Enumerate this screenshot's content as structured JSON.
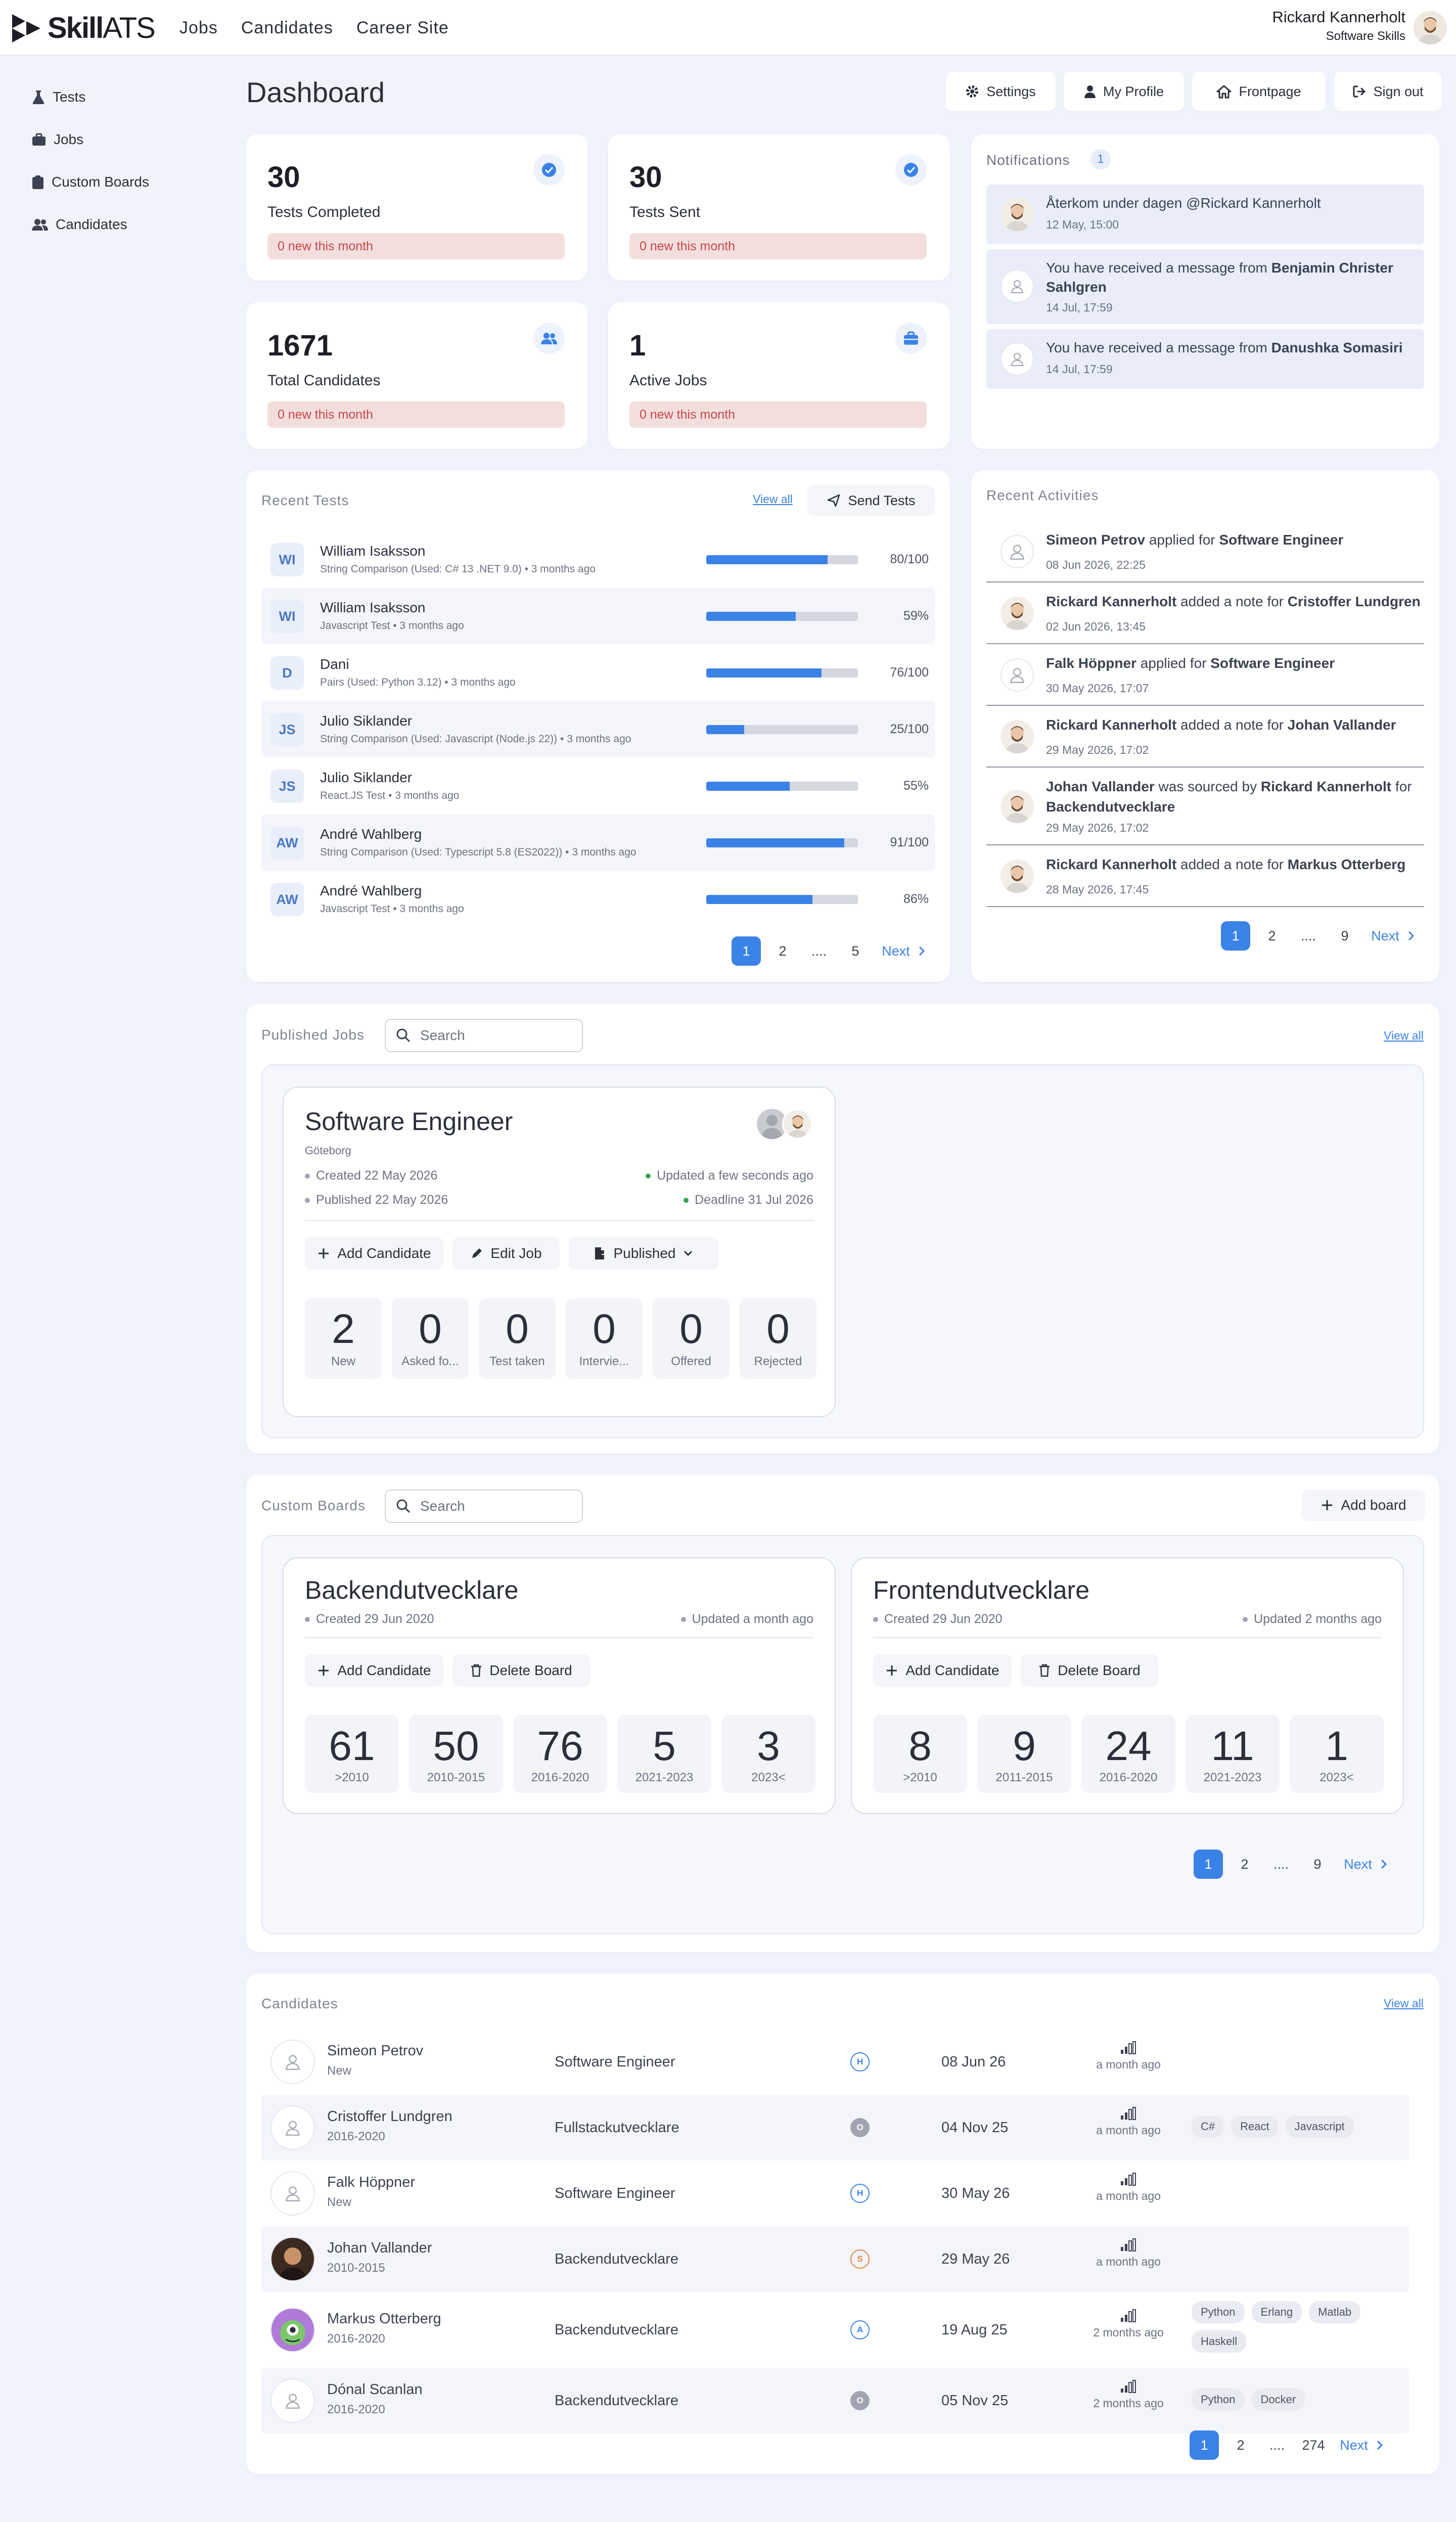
{
  "app": {
    "logo_bold": "Skill",
    "logo_light": "ATS",
    "nav": [
      "Jobs",
      "Candidates",
      "Career Site"
    ],
    "user_name": "Rickard Kannerholt",
    "user_company": "Software Skills"
  },
  "sidebar": {
    "items": [
      "Tests",
      "Jobs",
      "Custom Boards",
      "Candidates"
    ]
  },
  "page": {
    "title": "Dashboard"
  },
  "toolbar": {
    "settings": "Settings",
    "profile": "My Profile",
    "frontpage": "Frontpage",
    "signout": "Sign out"
  },
  "stats": [
    {
      "value": "30",
      "label": "Tests Completed",
      "badge": "0 new this month",
      "icon": "check-circle-icon"
    },
    {
      "value": "30",
      "label": "Tests Sent",
      "badge": "0 new this month",
      "icon": "check-circle-icon"
    },
    {
      "value": "1671",
      "label": "Total Candidates",
      "badge": "0 new this month",
      "icon": "users-icon"
    },
    {
      "value": "1",
      "label": "Active Jobs",
      "badge": "0 new this month",
      "icon": "briefcase-icon"
    }
  ],
  "notifications": {
    "title": "Notifications",
    "count": "1",
    "items": [
      {
        "text": "Återkom under dagen @Rickard Kannerholt",
        "date": "12 May, 15:00"
      },
      {
        "pre": "You have received a message from ",
        "bold": "Benjamin Christer Sahlgren",
        "date": "14 Jul, 17:59"
      },
      {
        "pre": "You have received a message from ",
        "bold": "Danushka Somasiri",
        "date": "14 Jul, 17:59"
      }
    ]
  },
  "recent_tests": {
    "title": "Recent Tests",
    "view_all": "View all",
    "send": "Send Tests",
    "rows": [
      {
        "initials": "WI",
        "name": "William Isaksson",
        "meta": "String Comparison (Used: C# 13 .NET 9.0) • 3 months ago",
        "score": "80/100",
        "pct": 0.8
      },
      {
        "initials": "WI",
        "name": "William Isaksson",
        "meta": "Javascript Test • 3 months ago",
        "score": "59%",
        "pct": 0.59
      },
      {
        "initials": "D",
        "name": "Dani",
        "meta": "Pairs (Used: Python 3.12) • 3 months ago",
        "score": "76/100",
        "pct": 0.76
      },
      {
        "initials": "JS",
        "name": "Julio Siklander",
        "meta": "String Comparison (Used: Javascript (Node.js 22)) • 3 months ago",
        "score": "25/100",
        "pct": 0.25
      },
      {
        "initials": "JS",
        "name": "Julio Siklander",
        "meta": "React.JS Test • 3 months ago",
        "score": "55%",
        "pct": 0.55
      },
      {
        "initials": "AW",
        "name": "André Wahlberg",
        "meta": "String Comparison (Used: Typescript 5.8 (ES2022)) • 3 months ago",
        "score": "91/100",
        "pct": 0.91
      },
      {
        "initials": "AW",
        "name": "André Wahlberg",
        "meta": "Javascript Test • 3 months ago",
        "score": "86%",
        "pct": 0.7
      }
    ],
    "pages": [
      "1",
      "2",
      "....",
      "5"
    ],
    "next": "Next"
  },
  "recent_activities": {
    "title": "Recent Activities",
    "items": [
      {
        "parts": [
          [
            "b",
            "Simeon Petrov"
          ],
          [
            "t",
            " applied for "
          ],
          [
            "b",
            "Software Engineer"
          ]
        ],
        "date": "08 Jun 2026, 22:25",
        "photo": false
      },
      {
        "parts": [
          [
            "b",
            "Rickard Kannerholt"
          ],
          [
            "t",
            " added a note for "
          ],
          [
            "b",
            "Cristoffer Lundgren"
          ]
        ],
        "date": "02 Jun 2026, 13:45",
        "photo": true
      },
      {
        "parts": [
          [
            "b",
            "Falk Höppner"
          ],
          [
            "t",
            " applied for "
          ],
          [
            "b",
            "Software Engineer"
          ]
        ],
        "date": "30 May 2026, 17:07",
        "photo": false
      },
      {
        "parts": [
          [
            "b",
            "Rickard Kannerholt"
          ],
          [
            "t",
            " added a note for "
          ],
          [
            "b",
            "Johan Vallander"
          ]
        ],
        "date": "29 May 2026, 17:02",
        "photo": true
      },
      {
        "parts": [
          [
            "b",
            "Johan Vallander"
          ],
          [
            "t",
            " was sourced by "
          ],
          [
            "b",
            "Rickard Kannerholt"
          ],
          [
            "t",
            " for "
          ],
          [
            "b",
            "Backendutvecklare"
          ]
        ],
        "date": "29 May 2026, 17:02",
        "photo": true
      },
      {
        "parts": [
          [
            "b",
            "Rickard Kannerholt"
          ],
          [
            "t",
            " added a note for "
          ],
          [
            "b",
            "Markus Otterberg"
          ]
        ],
        "date": "28 May 2026, 17:45",
        "photo": true
      }
    ],
    "pages": [
      "1",
      "2",
      "....",
      "9"
    ],
    "next": "Next"
  },
  "published_jobs": {
    "title": "Published Jobs",
    "search_placeholder": "Search",
    "view_all": "View all",
    "job": {
      "title": "Software Engineer",
      "location": "Göteborg",
      "created": "Created 22 May 2026",
      "published": "Published 22 May 2026",
      "updated": "Updated a few seconds ago",
      "deadline": "Deadline 31 Jul 2026",
      "add": "Add Candidate",
      "edit": "Edit Job",
      "status": "Published",
      "stages": [
        {
          "v": "2",
          "l": "New"
        },
        {
          "v": "0",
          "l": "Asked fo..."
        },
        {
          "v": "0",
          "l": "Test taken"
        },
        {
          "v": "0",
          "l": "Intervie..."
        },
        {
          "v": "0",
          "l": "Offered"
        },
        {
          "v": "0",
          "l": "Rejected"
        }
      ]
    }
  },
  "custom_boards": {
    "title": "Custom Boards",
    "search_placeholder": "Search",
    "add": "Add board",
    "boards": [
      {
        "title": "Backendutvecklare",
        "created": "Created 29 Jun 2020",
        "updated": "Updated a month ago",
        "add": "Add Candidate",
        "del": "Delete Board",
        "cols": [
          {
            "v": "61",
            "l": ">2010"
          },
          {
            "v": "50",
            "l": "2010-2015"
          },
          {
            "v": "76",
            "l": "2016-2020"
          },
          {
            "v": "5",
            "l": "2021-2023"
          },
          {
            "v": "3",
            "l": "2023<"
          }
        ]
      },
      {
        "title": "Frontendutvecklare",
        "created": "Created 29 Jun 2020",
        "updated": "Updated 2 months ago",
        "add": "Add Candidate",
        "del": "Delete Board",
        "cols": [
          {
            "v": "8",
            "l": ">2010"
          },
          {
            "v": "9",
            "l": "2011-2015"
          },
          {
            "v": "24",
            "l": "2016-2020"
          },
          {
            "v": "11",
            "l": "2021-2023"
          },
          {
            "v": "1",
            "l": "2023<"
          }
        ]
      }
    ],
    "pages": [
      "1",
      "2",
      "....",
      "9"
    ],
    "next": "Next"
  },
  "candidates": {
    "title": "Candidates",
    "view_all": "View all",
    "rows": [
      {
        "name": "Simeon Petrov",
        "stage": "New",
        "job": "Software Engineer",
        "src": "H",
        "src_color": "#3b82e7",
        "date": "08 Jun 26",
        "ago": "a month ago",
        "tags": [],
        "avatar": "person"
      },
      {
        "name": "Cristoffer Lundgren",
        "stage": "2016-2020",
        "job": "Fullstackutvecklare",
        "src": "O",
        "src_color": "#a0a4b0",
        "date": "04 Nov 25",
        "ago": "a month ago",
        "tags": [
          "C#",
          "React",
          "Javascript"
        ],
        "avatar": "person"
      },
      {
        "name": "Falk Höppner",
        "stage": "New",
        "job": "Software Engineer",
        "src": "H",
        "src_color": "#3b82e7",
        "date": "30 May 26",
        "ago": "a month ago",
        "tags": [],
        "avatar": "person"
      },
      {
        "name": "Johan Vallander",
        "stage": "2010-2015",
        "job": "Backendutvecklare",
        "src": "S",
        "src_color": "#e8853d",
        "date": "29 May 26",
        "ago": "a month ago",
        "tags": [],
        "avatar": "photo"
      },
      {
        "name": "Markus Otterberg",
        "stage": "2016-2020",
        "job": "Backendutvecklare",
        "src": "A",
        "src_color": "#3b82e7",
        "date": "19 Aug 25",
        "ago": "2 months ago",
        "tags": [
          "Python",
          "Erlang",
          "Matlab",
          "Haskell"
        ],
        "avatar": "monster"
      },
      {
        "name": "Dónal Scanlan",
        "stage": "2016-2020",
        "job": "Backendutvecklare",
        "src": "O",
        "src_color": "#a0a4b0",
        "date": "05 Nov 25",
        "ago": "2 months ago",
        "tags": [
          "Python",
          "Docker"
        ],
        "avatar": "person"
      }
    ],
    "pages": [
      "1",
      "2",
      "....",
      "274"
    ],
    "next": "Next"
  }
}
